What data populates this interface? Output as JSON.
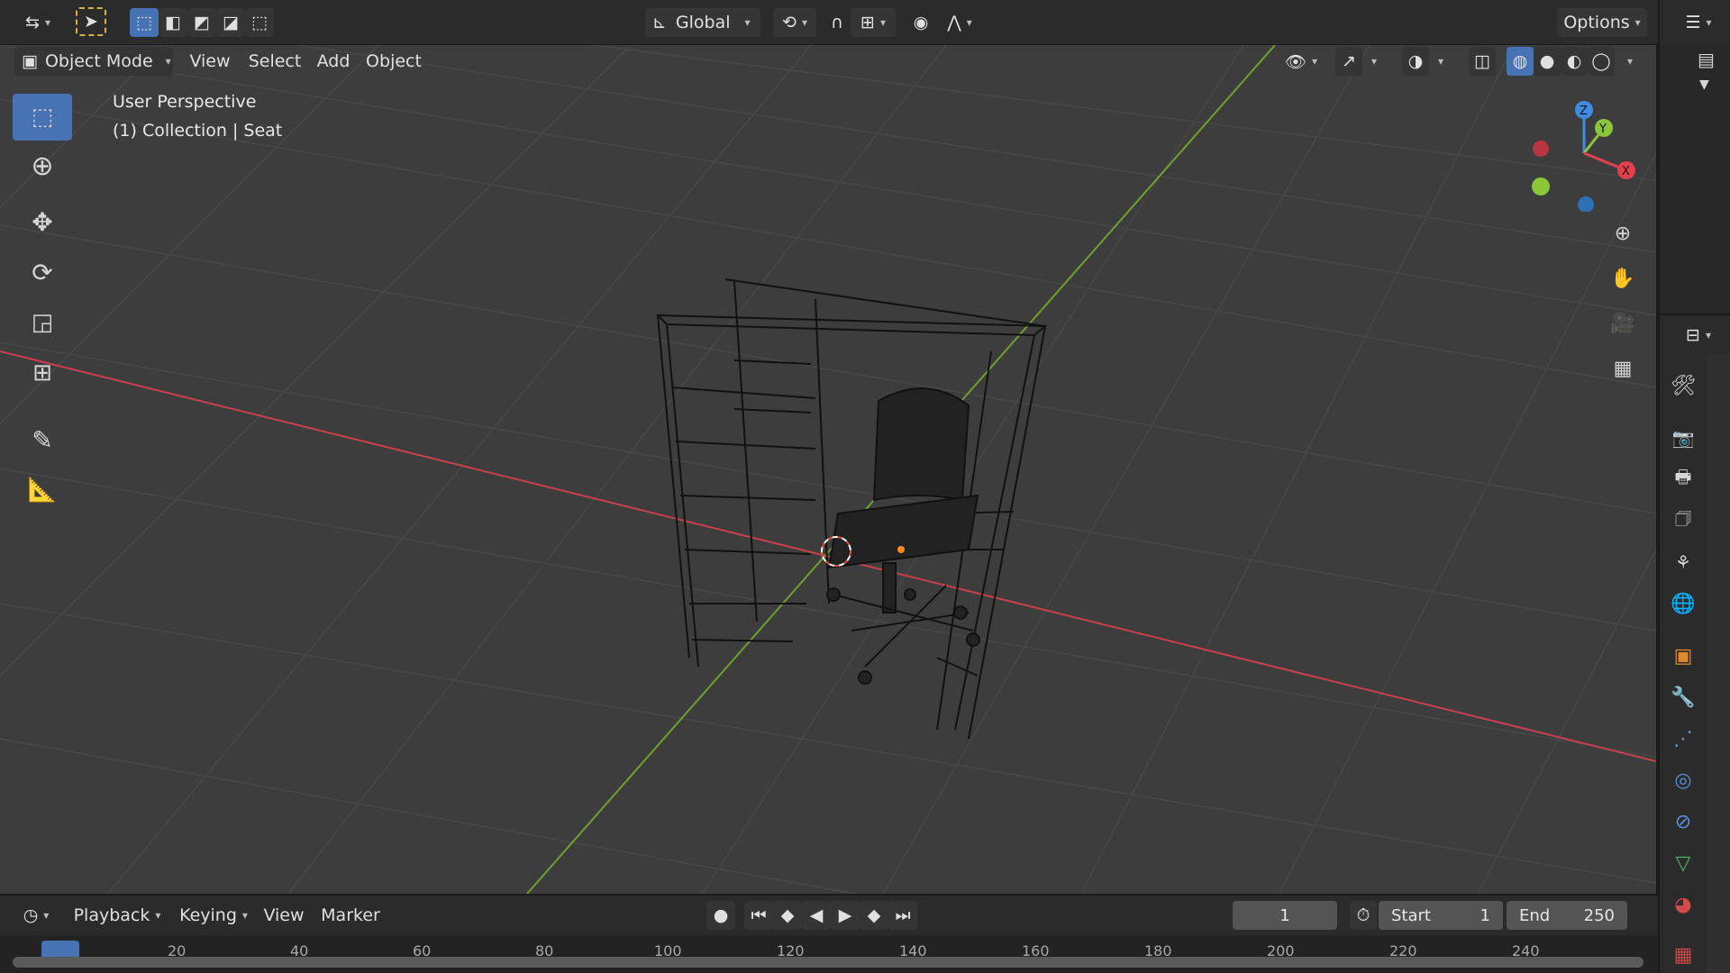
{
  "top_header": {
    "orientation": "Global",
    "options_label": "Options"
  },
  "viewport_header": {
    "mode": "Object Mode",
    "menus": [
      "View",
      "Select",
      "Add",
      "Object"
    ]
  },
  "viewport": {
    "view_name": "User Perspective",
    "collection_info": "(1) Collection | Seat"
  },
  "gizmo": {
    "axes": [
      "Z",
      "Y",
      "X"
    ],
    "colors": {
      "x": "#e2404b",
      "y": "#8bc53a",
      "z": "#3f8be6"
    }
  },
  "timeline": {
    "menus": [
      "Playback",
      "Keying",
      "View",
      "Marker"
    ],
    "current_frame": "1",
    "start_label": "Start",
    "start_value": "1",
    "end_label": "End",
    "end_value": "250",
    "ruler": [
      "20",
      "40",
      "60",
      "80",
      "100",
      "120",
      "140",
      "160",
      "180",
      "200",
      "220",
      "240"
    ]
  },
  "colors": {
    "accent": "#4772b3",
    "x_axis": "#c9404b",
    "y_axis": "#6fa12f"
  }
}
